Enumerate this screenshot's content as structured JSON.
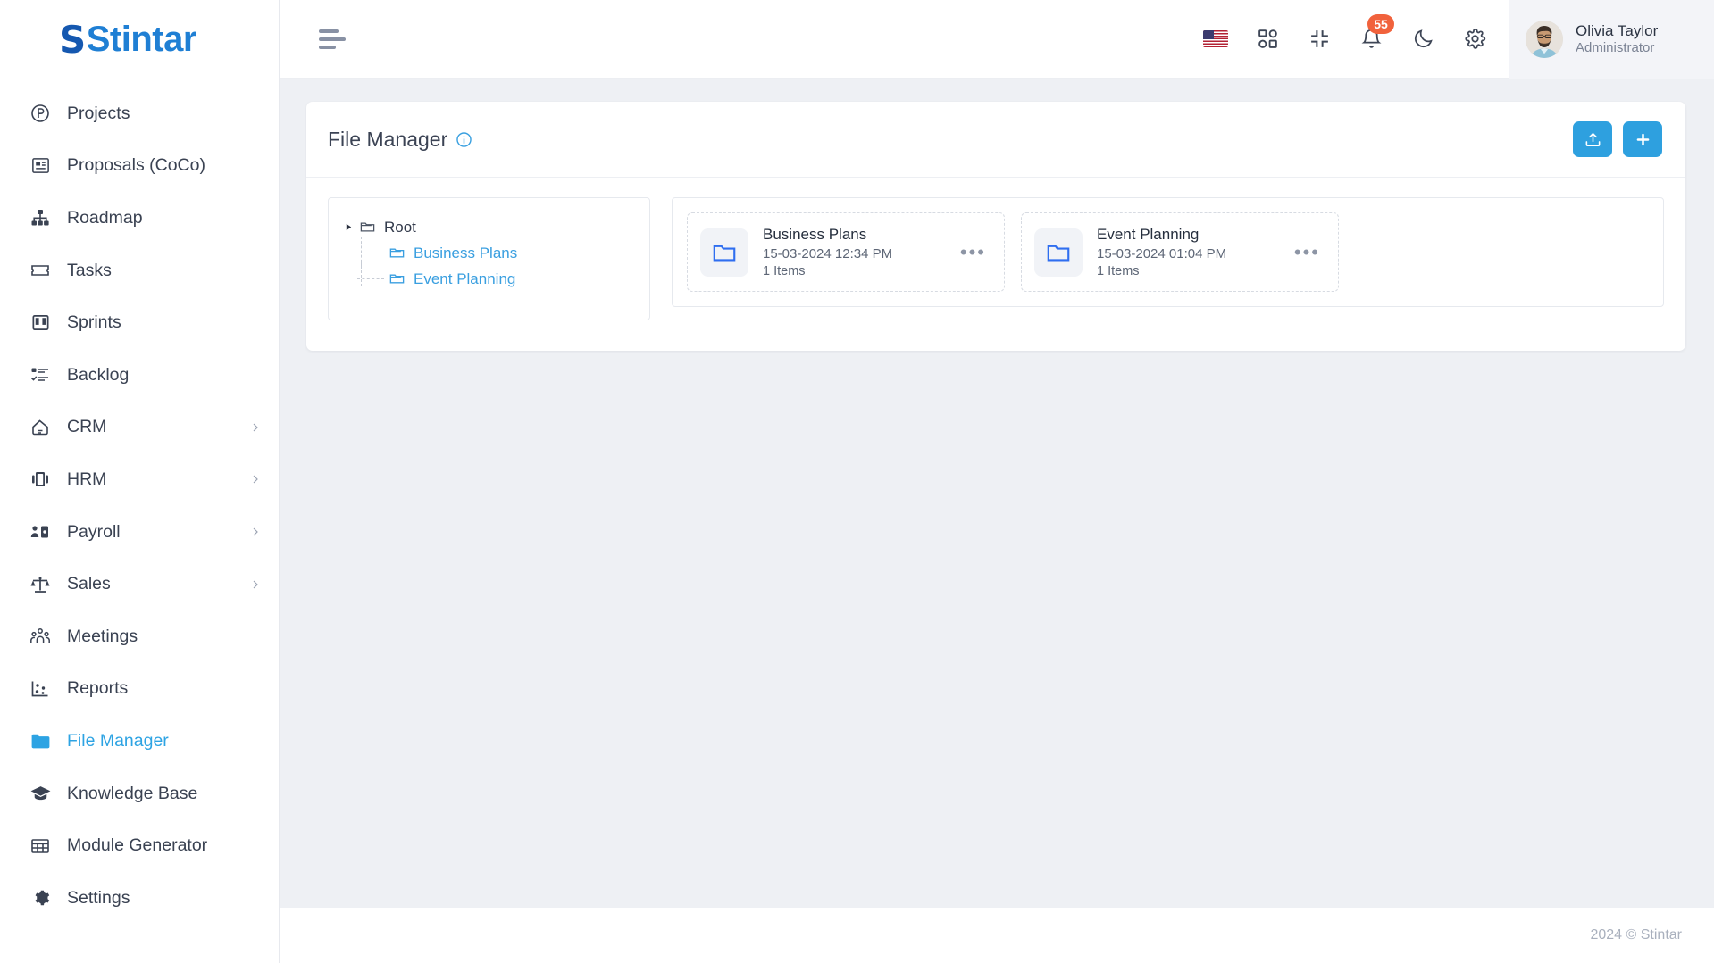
{
  "brand": {
    "logo_text": "Stintar",
    "logo_initial": "S"
  },
  "sidebar": {
    "items": [
      {
        "label": "Projects",
        "icon": "circle-p-icon",
        "has_chevron": false,
        "active": false
      },
      {
        "label": "Proposals (CoCo)",
        "icon": "proposal-icon",
        "has_chevron": false,
        "active": false
      },
      {
        "label": "Roadmap",
        "icon": "sitemap-icon",
        "has_chevron": false,
        "active": false
      },
      {
        "label": "Tasks",
        "icon": "ticket-icon",
        "has_chevron": false,
        "active": false
      },
      {
        "label": "Sprints",
        "icon": "board-icon",
        "has_chevron": false,
        "active": false
      },
      {
        "label": "Backlog",
        "icon": "checklist-icon",
        "has_chevron": false,
        "active": false
      },
      {
        "label": "CRM",
        "icon": "handshake-icon",
        "has_chevron": true,
        "active": false
      },
      {
        "label": "HRM",
        "icon": "people-card-icon",
        "has_chevron": true,
        "active": false
      },
      {
        "label": "Payroll",
        "icon": "person-money-icon",
        "has_chevron": true,
        "active": false
      },
      {
        "label": "Sales",
        "icon": "scales-icon",
        "has_chevron": true,
        "active": false
      },
      {
        "label": "Meetings",
        "icon": "group-icon",
        "has_chevron": false,
        "active": false
      },
      {
        "label": "Reports",
        "icon": "scatter-chart-icon",
        "has_chevron": false,
        "active": false
      },
      {
        "label": "File Manager",
        "icon": "folder-icon",
        "has_chevron": false,
        "active": true
      },
      {
        "label": "Knowledge Base",
        "icon": "graduation-cap-icon",
        "has_chevron": false,
        "active": false
      },
      {
        "label": "Module Generator",
        "icon": "grid-table-icon",
        "has_chevron": false,
        "active": false
      },
      {
        "label": "Settings",
        "icon": "gear-icon",
        "has_chevron": false,
        "active": false
      }
    ]
  },
  "topbar": {
    "menu_toggle": "hamburger-icon",
    "icons": [
      {
        "name": "language-flag-us",
        "label": ""
      },
      {
        "name": "apps-grid-icon",
        "label": ""
      },
      {
        "name": "compress-icon",
        "label": ""
      },
      {
        "name": "notifications-bell-icon",
        "label": ""
      },
      {
        "name": "dark-mode-moon-icon",
        "label": ""
      },
      {
        "name": "settings-gear-icon",
        "label": ""
      }
    ],
    "notification_count": "55",
    "profile": {
      "name": "Olivia Taylor",
      "role": "Administrator"
    }
  },
  "page": {
    "title": "File Manager",
    "info_tooltip_icon": "info-circle-icon",
    "actions": [
      {
        "name": "upload-button",
        "icon": "upload-icon"
      },
      {
        "name": "add-button",
        "icon": "plus-icon"
      }
    ]
  },
  "tree": {
    "root": {
      "label": "Root",
      "icon": "folder-open-icon"
    },
    "children": [
      {
        "label": "Business Plans",
        "icon": "folder-open-icon"
      },
      {
        "label": "Event Planning",
        "icon": "folder-open-icon"
      }
    ]
  },
  "folders": [
    {
      "name": "Business Plans",
      "date": "15-03-2024 12:34 PM",
      "items": "1 Items",
      "menu": "•••"
    },
    {
      "name": "Event Planning",
      "date": "15-03-2024 01:04 PM",
      "items": "1 Items",
      "menu": "•••"
    }
  ],
  "footer": {
    "copyright": "2024 © Stintar"
  },
  "colors": {
    "accent": "#2ea0df",
    "link": "#3a9fe0",
    "badge": "#f1623c",
    "page_bg": "#eef0f4",
    "text": "#3a4252"
  }
}
